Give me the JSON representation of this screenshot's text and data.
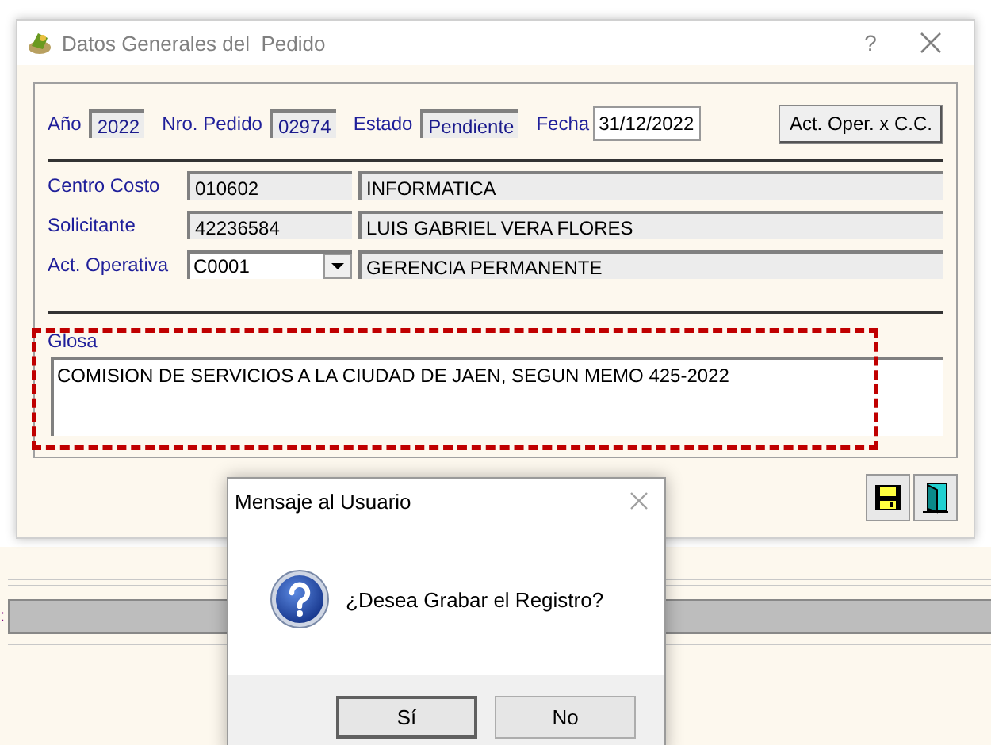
{
  "background_window": {
    "label_fragment": ":"
  },
  "window": {
    "title": "Datos Generales del  Pedido",
    "help": "?"
  },
  "header_fields": [
    {
      "label": "Año",
      "value": "2022",
      "disabled": true
    },
    {
      "label": "Nro. Pedido",
      "value": "02974",
      "disabled": true
    },
    {
      "label": "Estado",
      "value": "Pendiente",
      "disabled": true
    },
    {
      "label": "Fecha",
      "value": "31/12/2022",
      "disabled": false
    }
  ],
  "header_button": "Act. Oper. x C.C.",
  "rows": [
    {
      "label": "Centro Costo",
      "kind": "text",
      "code": "010602",
      "description": "INFORMATICA"
    },
    {
      "label": "Solicitante",
      "kind": "text",
      "code": "42236584",
      "description": "LUIS GABRIEL VERA FLORES"
    },
    {
      "label": "Act. Operativa",
      "kind": "combo",
      "code": "C0001",
      "description": "GERENCIA PERMANENTE"
    }
  ],
  "glosa": {
    "label": "Glosa",
    "value": "COMISION DE SERVICIOS A LA CIUDAD DE JAEN, SEGUN MEMO 425-2022"
  },
  "toolbar": [
    {
      "kind": "save"
    },
    {
      "kind": "exit"
    }
  ],
  "dialog": {
    "title": "Mensaje al Usuario",
    "message": "¿Desea Grabar el Registro?",
    "buttons": [
      {
        "label": "Sí",
        "default": true
      },
      {
        "label": "No",
        "default": false
      }
    ]
  }
}
